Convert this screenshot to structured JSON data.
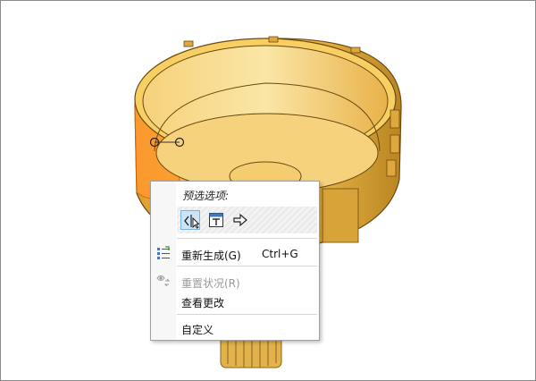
{
  "context_menu": {
    "title": "预选选项:",
    "filter_buttons": [
      {
        "icon": "geometry-filter-icon",
        "selected": true
      },
      {
        "icon": "feature-filter-icon",
        "selected": false
      },
      {
        "icon": "arrow-right-icon",
        "selected": false
      }
    ],
    "items": [
      {
        "label": "重新生成(G)",
        "shortcut": "Ctrl+G",
        "icon": "regenerate-icon",
        "enabled": true
      },
      {
        "label": "重置状况(R)",
        "icon": "reset-status-icon",
        "enabled": false
      },
      {
        "label": "查看更改",
        "enabled": true
      },
      {
        "label": "自定义",
        "enabled": true
      }
    ]
  },
  "colors": {
    "part_fill": "#f2b941",
    "part_highlight": "#ff8c1a",
    "selection_blue": "#cce4f7"
  }
}
